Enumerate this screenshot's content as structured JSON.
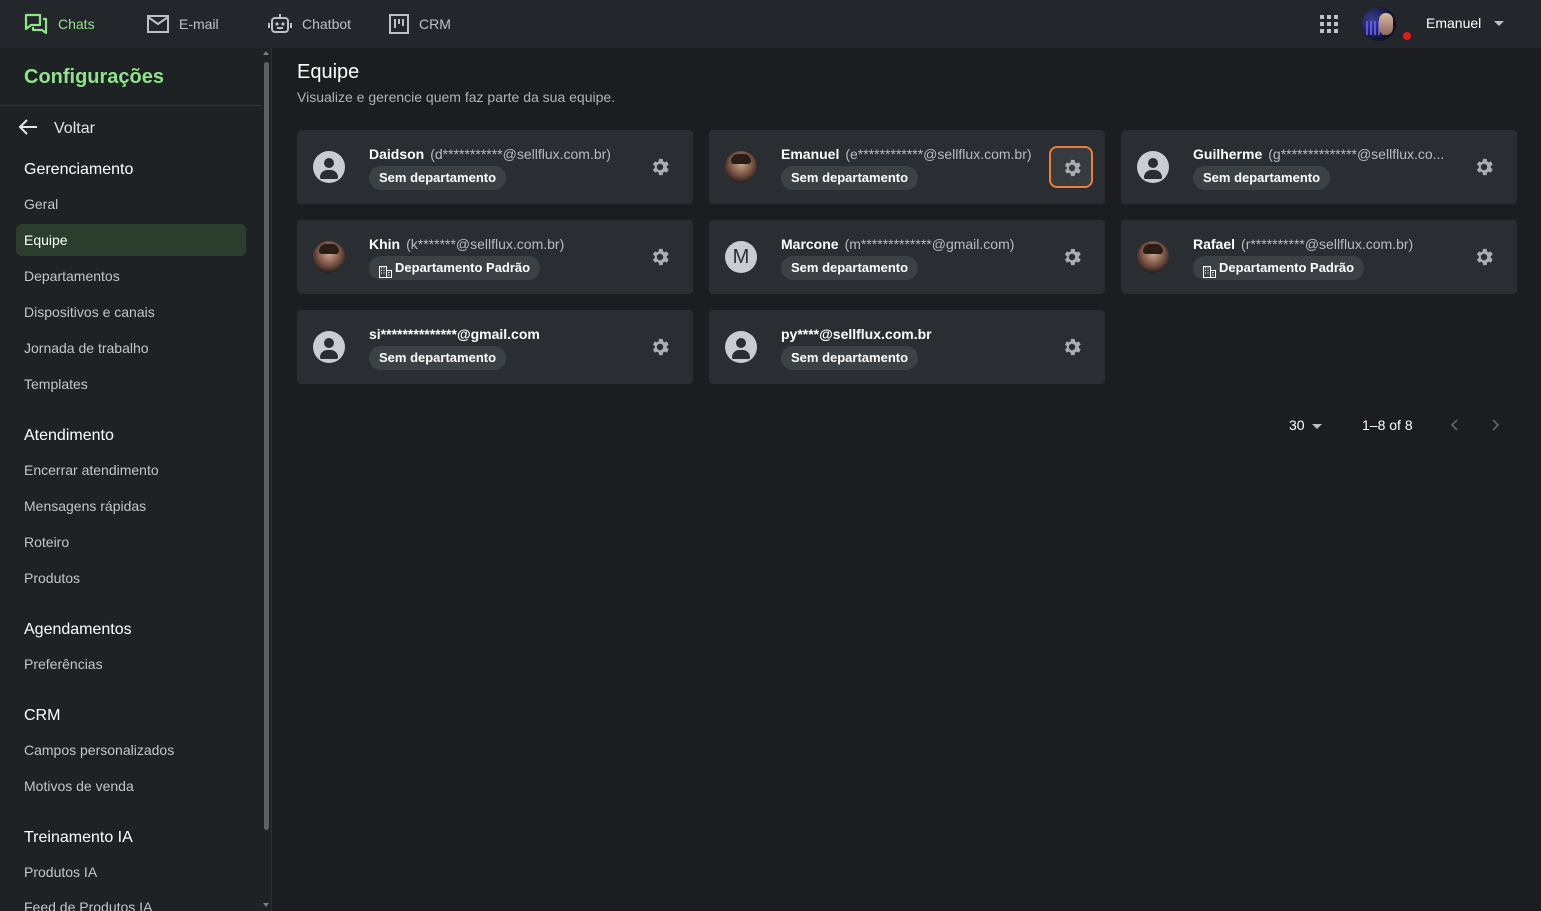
{
  "topnav": {
    "items": [
      {
        "label": "Chats",
        "icon": "chat-icon",
        "active": true
      },
      {
        "label": "E-mail",
        "icon": "mail-icon",
        "active": false
      },
      {
        "label": "Chatbot",
        "icon": "robot-icon",
        "active": false
      },
      {
        "label": "CRM",
        "icon": "kanban-icon",
        "active": false
      }
    ],
    "user_name": "Emanuel",
    "accent_color": "#8fe38a",
    "status_color": "#e11b1b"
  },
  "sidebar": {
    "title": "Configurações",
    "back_label": "Voltar",
    "sections": [
      {
        "heading": "Gerenciamento",
        "items": [
          "Geral",
          "Equipe",
          "Departamentos",
          "Dispositivos e canais",
          "Jornada de trabalho",
          "Templates"
        ]
      },
      {
        "heading": "Atendimento",
        "items": [
          "Encerrar atendimento",
          "Mensagens rápidas",
          "Roteiro",
          "Produtos"
        ]
      },
      {
        "heading": "Agendamentos",
        "items": [
          "Preferências"
        ]
      },
      {
        "heading": "CRM",
        "items": [
          "Campos personalizados",
          "Motivos de venda"
        ]
      },
      {
        "heading": "Treinamento IA",
        "items": [
          "Produtos IA",
          "Feed de Produtos IA"
        ]
      }
    ],
    "active_item": "Equipe"
  },
  "main": {
    "title": "Equipe",
    "subtitle": "Visualize e gerencie quem faz parte da sua equipe.",
    "members": [
      {
        "name": "Daidson",
        "email": "(d***********@sellflux.com.br)",
        "department": "Sem departamento",
        "avatar": "person",
        "dept_icon": false
      },
      {
        "name": "Emanuel",
        "email": "(e************@sellflux.com.br)",
        "department": "Sem departamento",
        "avatar": "photo",
        "dept_icon": false
      },
      {
        "name": "Guilherme",
        "email": "(g**************@sellflux.co...",
        "department": "Sem departamento",
        "avatar": "person",
        "dept_icon": false
      },
      {
        "name": "Khin",
        "email": "(k*******@sellflux.com.br)",
        "department": "Departamento Padrão",
        "avatar": "photo",
        "dept_icon": true
      },
      {
        "name": "Marcone",
        "email": "(m*************@gmail.com)",
        "department": "Sem departamento",
        "avatar": "letter",
        "avatar_letter": "M",
        "dept_icon": false
      },
      {
        "name": "Rafael",
        "email": "(r**********@sellflux.com.br)",
        "department": "Departamento Padrão",
        "avatar": "photo",
        "dept_icon": true
      },
      {
        "name": "",
        "email": "si**************@gmail.com",
        "department": "Sem departamento",
        "avatar": "person",
        "dept_icon": false
      },
      {
        "name": "",
        "email": "py****@sellflux.com.br",
        "department": "Sem departamento",
        "avatar": "person",
        "dept_icon": false
      }
    ],
    "focused_settings_index": 1,
    "focus_color": "#f17a3c"
  },
  "pagination": {
    "page_size": "30",
    "range": "1–8 of 8"
  }
}
